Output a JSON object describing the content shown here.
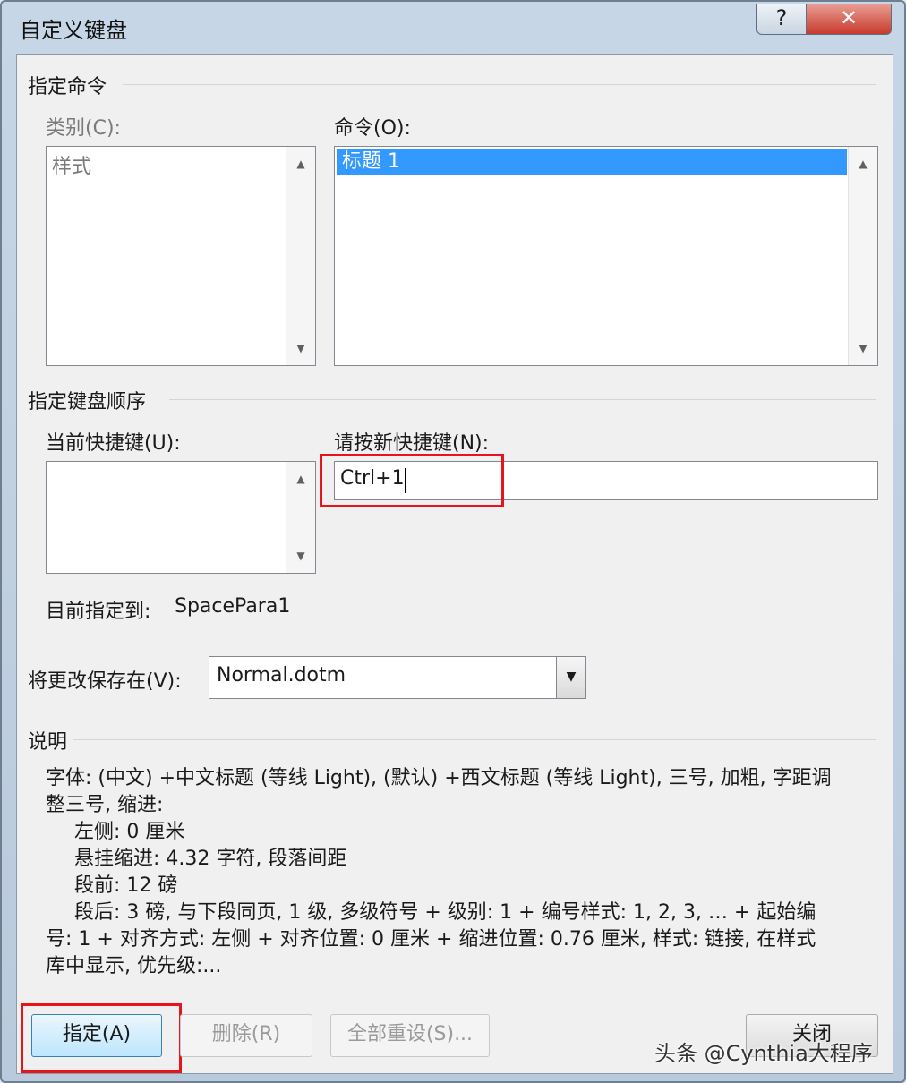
{
  "window": {
    "title": "自定义键盘",
    "help_label": "?",
    "close_label": "✕"
  },
  "specify_command": {
    "heading": "指定命令",
    "category_label": "类别(C):",
    "category_items": [
      "样式"
    ],
    "command_label": "命令(O):",
    "command_items": [
      "标题 1"
    ]
  },
  "keyboard_sequence": {
    "heading": "指定键盘顺序",
    "current_keys_label": "当前快捷键(U):",
    "new_key_label": "请按新快捷键(N):",
    "new_key_value": "Ctrl+1",
    "assigned_to_label": "目前指定到:",
    "assigned_to_value": "SpacePara1"
  },
  "save_in": {
    "label": "将更改保存在(V):",
    "value": "Normal.dotm"
  },
  "description": {
    "heading": "说明",
    "lines": [
      "字体: (中文) +中文标题 (等线 Light), (默认) +西文标题 (等线 Light), 三号, 加粗, 字距调",
      "整三号, 缩进:",
      "左侧:  0 厘米",
      "悬挂缩进: 4.32 字符, 段落间距",
      "段前: 12 磅",
      "段后: 3 磅, 与下段同页, 1 级, 多级符号 + 级别: 1 + 编号样式: 1, 2, 3, … + 起始编",
      "号: 1 + 对齐方式: 左侧 + 对齐位置:  0 厘米 + 缩进位置:  0.76 厘米, 样式: 链接, 在样式",
      "库中显示, 优先级:..."
    ]
  },
  "buttons": {
    "assign": "指定(A)",
    "remove": "删除(R)",
    "reset_all": "全部重设(S)...",
    "close": "关闭"
  },
  "watermark": "头条 @Cynthia大程序",
  "colors": {
    "highlight": "#3399ff",
    "red_outline": "#e8141b"
  }
}
